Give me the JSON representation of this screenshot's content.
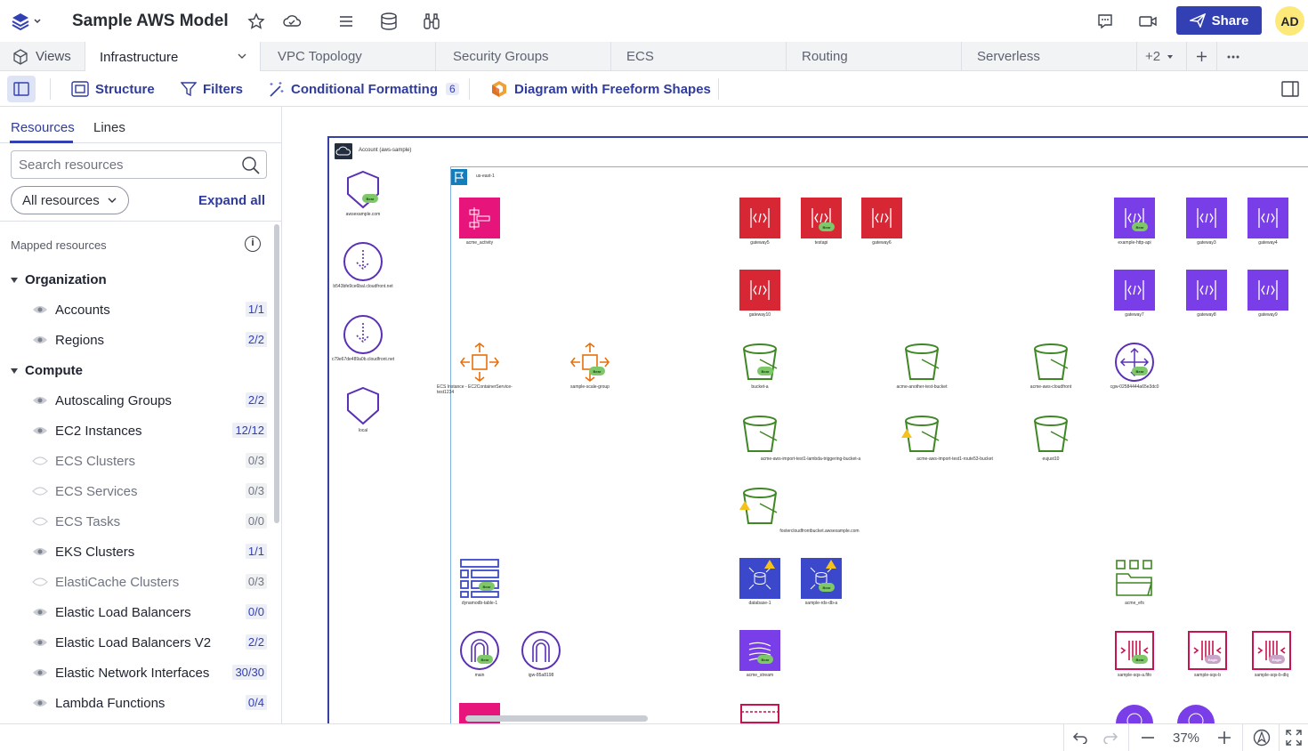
{
  "app": {
    "title": "Sample AWS Model",
    "share_label": "Share",
    "avatar_initials": "AD"
  },
  "tabs": {
    "views_label": "Views",
    "items": [
      {
        "label": "Infrastructure"
      },
      {
        "label": "VPC Topology"
      },
      {
        "label": "Security Groups"
      },
      {
        "label": "ECS"
      },
      {
        "label": "Routing"
      },
      {
        "label": "Serverless"
      }
    ],
    "more_label": "+2"
  },
  "toolbar": {
    "structure_label": "Structure",
    "filters_label": "Filters",
    "conditional_label": "Conditional Formatting",
    "conditional_count": "6",
    "diagram_label": "Diagram with Freeform Shapes"
  },
  "sidebar": {
    "tab_resources": "Resources",
    "tab_lines": "Lines",
    "search_placeholder": "Search resources",
    "filter_label": "All resources",
    "expand_label": "Expand all",
    "mapped_label": "Mapped resources",
    "groups": [
      {
        "label": "Organization",
        "items": [
          {
            "label": "Accounts",
            "count": "1/1",
            "visible": true
          },
          {
            "label": "Regions",
            "count": "2/2",
            "visible": true
          }
        ]
      },
      {
        "label": "Compute",
        "items": [
          {
            "label": "Autoscaling Groups",
            "count": "2/2",
            "visible": true
          },
          {
            "label": "EC2 Instances",
            "count": "12/12",
            "visible": true
          },
          {
            "label": "ECS Clusters",
            "count": "0/3",
            "visible": false
          },
          {
            "label": "ECS Services",
            "count": "0/3",
            "visible": false
          },
          {
            "label": "ECS Tasks",
            "count": "0/0",
            "visible": false
          },
          {
            "label": "EKS Clusters",
            "count": "1/1",
            "visible": true
          },
          {
            "label": "ElastiCache Clusters",
            "count": "0/3",
            "visible": false
          },
          {
            "label": "Elastic Load Balancers",
            "count": "0/0",
            "visible": true
          },
          {
            "label": "Elastic Load Balancers V2",
            "count": "2/2",
            "visible": true
          },
          {
            "label": "Elastic Network Interfaces",
            "count": "30/30",
            "visible": true
          },
          {
            "label": "Lambda Functions",
            "count": "0/4",
            "visible": true
          }
        ]
      }
    ]
  },
  "canvas": {
    "account_label": "Account (aws-sample)",
    "vpc_label": "us-east-1",
    "badge_bear": "Bear",
    "badge_eagle": "Eagle",
    "left_nodes": [
      "awsexample.com",
      "b543bfe9ce6bal.cloudfront.net",
      "c79e67de489a0b.cloudfront.net",
      "local"
    ],
    "nodes": {
      "acme_activity": "acme_activity",
      "gateway5": "gateway5",
      "testapi": "testapi",
      "gateway6": "gateway6",
      "gateway10": "gateway10",
      "example_http_api": "example-http-api",
      "gateway3": "gateway3",
      "gateway4": "gateway4",
      "gateway7": "gateway7",
      "gateway8": "gateway8",
      "gateway9": "gateway9",
      "ecs_instance": "ECS Instance - EC2ContainerService-test1234",
      "sample_scale_group": "sample-scale-group",
      "bucket_a": "bucket-a",
      "acme_another_test_bucket": "acme-another-test-bucket",
      "acme_aws_cloudfront": "acme-aws-cloudfront",
      "cgw": "cgw-02584444a65e3dc0",
      "import_lambda_bucket": "acme-aws-import-test1-lambda-triggering-bucket-a",
      "import_route53_bucket": "acme-aws-import-test1-route53-bucket",
      "eujust10": "eujust10",
      "fostercloudfront_bucket": "fostercloudfrontbucket.awsexample.com",
      "dynamodb_table": "dynamodb-table-1",
      "database_1": "database-1",
      "sample_rds_db": "sample-rds-db-a",
      "acme_efs": "acme_efs",
      "main": "main",
      "igw": "igw-85a8198",
      "acme_stream": "acme_stream",
      "sample_sqs_fifo": "sample-sqs-a.fifo",
      "sample_sqs_b": "sample-sqs-b",
      "sample_sqs_dlq": "sample-sqs-b-dlq"
    }
  },
  "status": {
    "zoom": "37%"
  },
  "colors": {
    "accent": "#3340b3",
    "api_red": "#d72735",
    "apigw_purple": "#7a3ee8",
    "s3_green": "#3f8624",
    "ec2_orange": "#e8700b",
    "db_blue": "#3b48cc",
    "sqs_pink": "#c7134f"
  }
}
